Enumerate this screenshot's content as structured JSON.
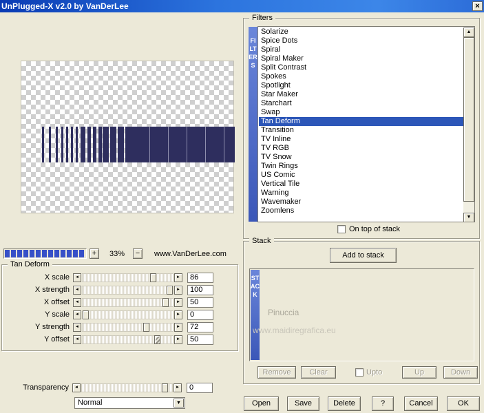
{
  "window": {
    "title": "UnPlugged-X v2.0 by VanDerLee"
  },
  "icons": {
    "close": "×",
    "left_arrow": "◄",
    "right_arrow": "►",
    "up_arrow": "▲",
    "down_arrow": "▼",
    "dropdown_arrow": "▼"
  },
  "preview": {
    "zoom_in": "+",
    "zoom_level": "33%",
    "zoom_out": "−",
    "website": "www.VanDerLee.com"
  },
  "filters": {
    "group_label": "Filters",
    "vertical_label": "FILTERS",
    "selected": "Tan Deform",
    "items": [
      "Solarize",
      "Spice Dots",
      "Spiral",
      "Spiral Maker",
      "Split Contrast",
      "Spokes",
      "Spotlight",
      "Star Maker",
      "Starchart",
      "Swap",
      "Tan Deform",
      "Transition",
      "TV Inline",
      "TV RGB",
      "TV Snow",
      "Twin Rings",
      "US Comic",
      "Vertical Tile",
      "Warning",
      "Wavemaker",
      "Zoomlens"
    ],
    "on_top_checkbox": "On top of stack"
  },
  "stack": {
    "group_label": "Stack",
    "add_button": "Add to stack",
    "vertical_label": "STACK",
    "watermark_name": "Pinuccia",
    "watermark_url": "www.maidiregrafica.eu",
    "remove_button": "Remove",
    "clear_button": "Clear",
    "upto_checkbox": "Upto",
    "up_button": "Up",
    "down_button": "Down"
  },
  "controls": {
    "group_label": "Tan Deform",
    "sliders": [
      {
        "label": "X scale",
        "value": "86",
        "pos": 80,
        "hatched": false
      },
      {
        "label": "X strength",
        "value": "100",
        "pos": 100,
        "hatched": false
      },
      {
        "label": "X offset",
        "value": "50",
        "pos": 95,
        "hatched": false
      },
      {
        "label": "Y scale",
        "value": "0",
        "pos": 0,
        "hatched": false
      },
      {
        "label": "Y strength",
        "value": "72",
        "pos": 72,
        "hatched": false
      },
      {
        "label": "Y offset",
        "value": "50",
        "pos": 85,
        "hatched": true
      }
    ],
    "transparency": {
      "label": "Transparency",
      "value": "0",
      "pos": 95
    },
    "blend_mode": "Normal"
  },
  "footer": {
    "open": "Open",
    "save": "Save",
    "delete": "Delete",
    "help": "?",
    "cancel": "Cancel",
    "ok": "OK"
  }
}
